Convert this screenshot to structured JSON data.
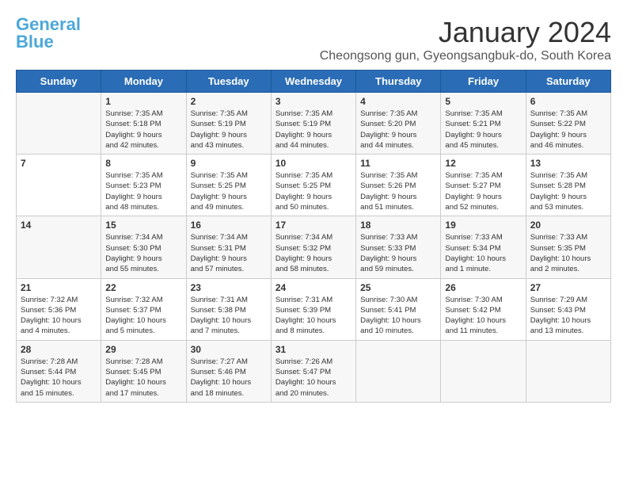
{
  "logo": {
    "line1": "General",
    "line2": "Blue"
  },
  "header": {
    "month": "January 2024",
    "location": "Cheongsong gun, Gyeongsangbuk-do, South Korea"
  },
  "weekdays": [
    "Sunday",
    "Monday",
    "Tuesday",
    "Wednesday",
    "Thursday",
    "Friday",
    "Saturday"
  ],
  "weeks": [
    [
      {
        "day": "",
        "details": ""
      },
      {
        "day": "1",
        "details": "Sunrise: 7:35 AM\nSunset: 5:18 PM\nDaylight: 9 hours\nand 42 minutes."
      },
      {
        "day": "2",
        "details": "Sunrise: 7:35 AM\nSunset: 5:19 PM\nDaylight: 9 hours\nand 43 minutes."
      },
      {
        "day": "3",
        "details": "Sunrise: 7:35 AM\nSunset: 5:19 PM\nDaylight: 9 hours\nand 44 minutes."
      },
      {
        "day": "4",
        "details": "Sunrise: 7:35 AM\nSunset: 5:20 PM\nDaylight: 9 hours\nand 44 minutes."
      },
      {
        "day": "5",
        "details": "Sunrise: 7:35 AM\nSunset: 5:21 PM\nDaylight: 9 hours\nand 45 minutes."
      },
      {
        "day": "6",
        "details": "Sunrise: 7:35 AM\nSunset: 5:22 PM\nDaylight: 9 hours\nand 46 minutes."
      }
    ],
    [
      {
        "day": "7",
        "details": ""
      },
      {
        "day": "8",
        "details": "Sunrise: 7:35 AM\nSunset: 5:23 PM\nDaylight: 9 hours\nand 48 minutes."
      },
      {
        "day": "9",
        "details": "Sunrise: 7:35 AM\nSunset: 5:25 PM\nDaylight: 9 hours\nand 49 minutes."
      },
      {
        "day": "10",
        "details": "Sunrise: 7:35 AM\nSunset: 5:25 PM\nDaylight: 9 hours\nand 50 minutes."
      },
      {
        "day": "11",
        "details": "Sunrise: 7:35 AM\nSunset: 5:26 PM\nDaylight: 9 hours\nand 51 minutes."
      },
      {
        "day": "12",
        "details": "Sunrise: 7:35 AM\nSunset: 5:27 PM\nDaylight: 9 hours\nand 52 minutes."
      },
      {
        "day": "13",
        "details": "Sunrise: 7:35 AM\nSunset: 5:28 PM\nDaylight: 9 hours\nand 53 minutes."
      }
    ],
    [
      {
        "day": "14",
        "details": ""
      },
      {
        "day": "15",
        "details": "Sunrise: 7:34 AM\nSunset: 5:30 PM\nDaylight: 9 hours\nand 55 minutes."
      },
      {
        "day": "16",
        "details": "Sunrise: 7:34 AM\nSunset: 5:31 PM\nDaylight: 9 hours\nand 57 minutes."
      },
      {
        "day": "17",
        "details": "Sunrise: 7:34 AM\nSunset: 5:32 PM\nDaylight: 9 hours\nand 58 minutes."
      },
      {
        "day": "18",
        "details": "Sunrise: 7:33 AM\nSunset: 5:33 PM\nDaylight: 9 hours\nand 59 minutes."
      },
      {
        "day": "19",
        "details": "Sunrise: 7:33 AM\nSunset: 5:34 PM\nDaylight: 10 hours\nand 1 minute."
      },
      {
        "day": "20",
        "details": "Sunrise: 7:33 AM\nSunset: 5:35 PM\nDaylight: 10 hours\nand 2 minutes."
      }
    ],
    [
      {
        "day": "21",
        "details": "Sunrise: 7:32 AM\nSunset: 5:36 PM\nDaylight: 10 hours\nand 4 minutes."
      },
      {
        "day": "22",
        "details": "Sunrise: 7:32 AM\nSunset: 5:37 PM\nDaylight: 10 hours\nand 5 minutes."
      },
      {
        "day": "23",
        "details": "Sunrise: 7:31 AM\nSunset: 5:38 PM\nDaylight: 10 hours\nand 7 minutes."
      },
      {
        "day": "24",
        "details": "Sunrise: 7:31 AM\nSunset: 5:39 PM\nDaylight: 10 hours\nand 8 minutes."
      },
      {
        "day": "25",
        "details": "Sunrise: 7:30 AM\nSunset: 5:41 PM\nDaylight: 10 hours\nand 10 minutes."
      },
      {
        "day": "26",
        "details": "Sunrise: 7:30 AM\nSunset: 5:42 PM\nDaylight: 10 hours\nand 11 minutes."
      },
      {
        "day": "27",
        "details": "Sunrise: 7:29 AM\nSunset: 5:43 PM\nDaylight: 10 hours\nand 13 minutes."
      }
    ],
    [
      {
        "day": "28",
        "details": "Sunrise: 7:28 AM\nSunset: 5:44 PM\nDaylight: 10 hours\nand 15 minutes."
      },
      {
        "day": "29",
        "details": "Sunrise: 7:28 AM\nSunset: 5:45 PM\nDaylight: 10 hours\nand 17 minutes."
      },
      {
        "day": "30",
        "details": "Sunrise: 7:27 AM\nSunset: 5:46 PM\nDaylight: 10 hours\nand 18 minutes."
      },
      {
        "day": "31",
        "details": "Sunrise: 7:26 AM\nSunset: 5:47 PM\nDaylight: 10 hours\nand 20 minutes."
      },
      {
        "day": "",
        "details": ""
      },
      {
        "day": "",
        "details": ""
      },
      {
        "day": "",
        "details": ""
      }
    ]
  ]
}
